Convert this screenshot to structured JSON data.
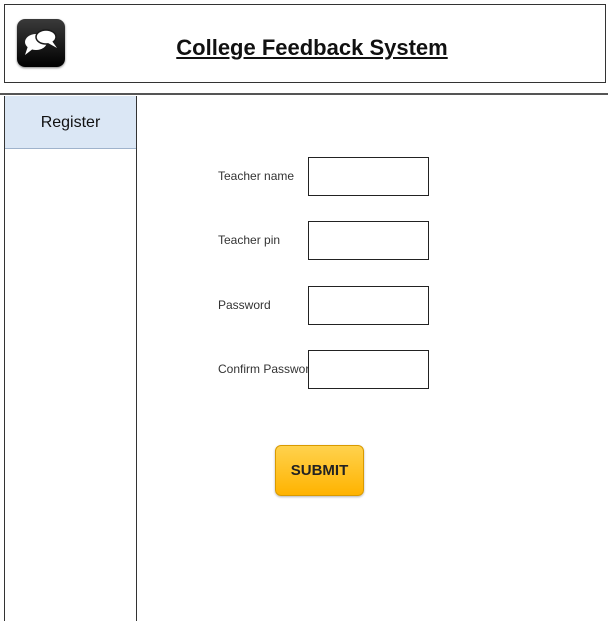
{
  "header": {
    "title": "College Feedback System",
    "logo_icon": "chat-bubbles-icon"
  },
  "sidebar": {
    "items": [
      {
        "label": "Register",
        "selected": true
      }
    ]
  },
  "form": {
    "fields": [
      {
        "label": "Teacher name",
        "value": ""
      },
      {
        "label": "Teacher pin",
        "value": ""
      },
      {
        "label": "Password",
        "value": ""
      },
      {
        "label": "Confirm Password",
        "value": ""
      }
    ],
    "submit_label": "SUBMIT"
  },
  "colors": {
    "sidebar_selected": "#dbe7f5",
    "submit_button": "#ffc21a"
  }
}
